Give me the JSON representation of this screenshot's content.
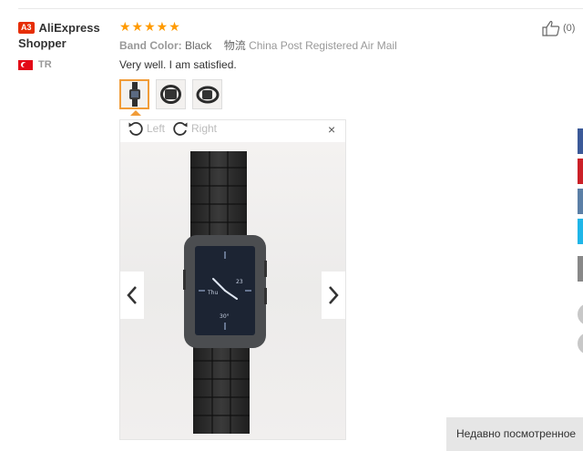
{
  "buyer": {
    "badge": "A3",
    "name": "AliExpress Shopper",
    "country": "TR"
  },
  "review": {
    "stars": "★★★★★",
    "band_label": "Band Color:",
    "band_value": "Black",
    "ship_label": "物流",
    "ship_value": "China Post Registered Air Mail",
    "comment": "Very well. I am satisfied."
  },
  "helpful": {
    "count": "(0)"
  },
  "viewer": {
    "rotate_left": "Left",
    "rotate_right": "Right",
    "close": "×",
    "watch_labels": {
      "day": "Thu",
      "date": "23",
      "temp": "30°"
    }
  },
  "share_colors": [
    "#3b5998",
    "#cb2027",
    "#5b7fa6",
    "#1fb6e8",
    "#888888"
  ],
  "footer": {
    "recently_viewed": "Недавно посмотренное"
  }
}
